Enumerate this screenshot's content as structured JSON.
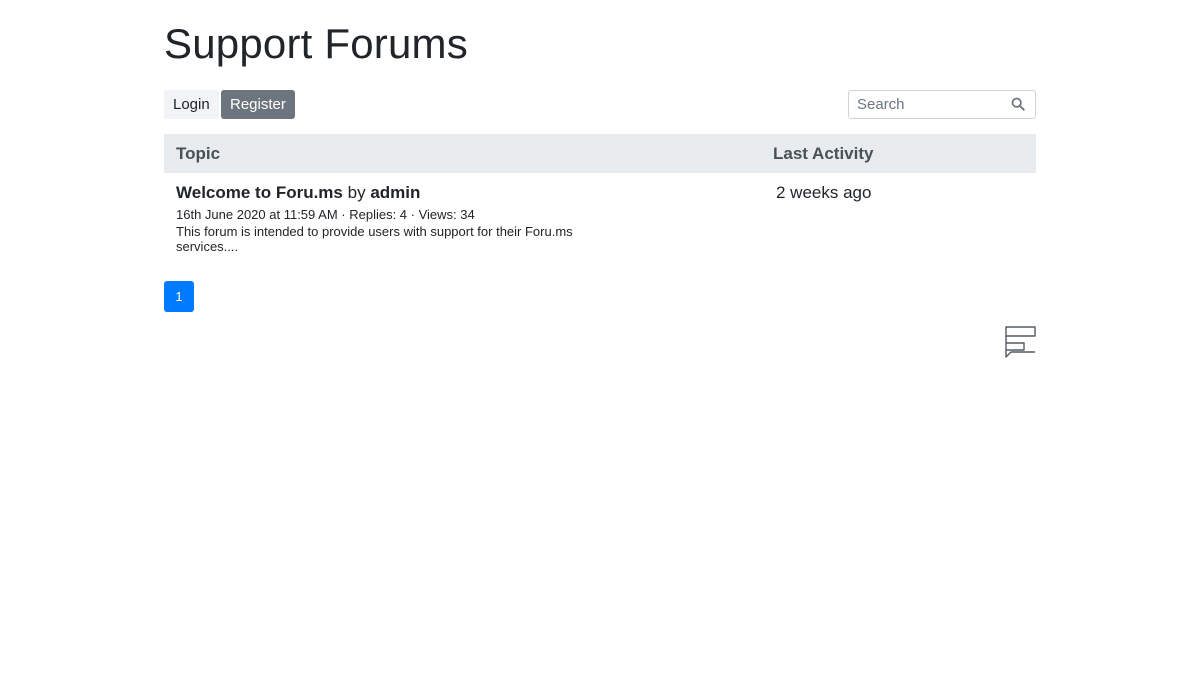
{
  "header": {
    "title": "Support Forums"
  },
  "toolbar": {
    "login_label": "Login",
    "register_label": "Register",
    "search_placeholder": "Search",
    "search_value": ""
  },
  "table": {
    "columns": [
      "Topic",
      "Last Activity"
    ],
    "rows": [
      {
        "title": "Welcome to Foru.ms",
        "by": "by",
        "author": "admin",
        "meta": "16th June 2020 at 11:59 AM · Replies: 4 · Views: 34",
        "excerpt": "This forum is intended to provide users with support for their Foru.ms services....",
        "last_activity": "2 weeks ago"
      }
    ]
  },
  "pagination": {
    "pages": [
      "1"
    ],
    "current": "1"
  },
  "icons": {
    "search": "search-icon",
    "logo": "forum-logo-icon"
  },
  "colors": {
    "primary": "#007bff",
    "secondary": "#6c757d",
    "header_bg": "#e9ecef",
    "text": "#212529"
  }
}
